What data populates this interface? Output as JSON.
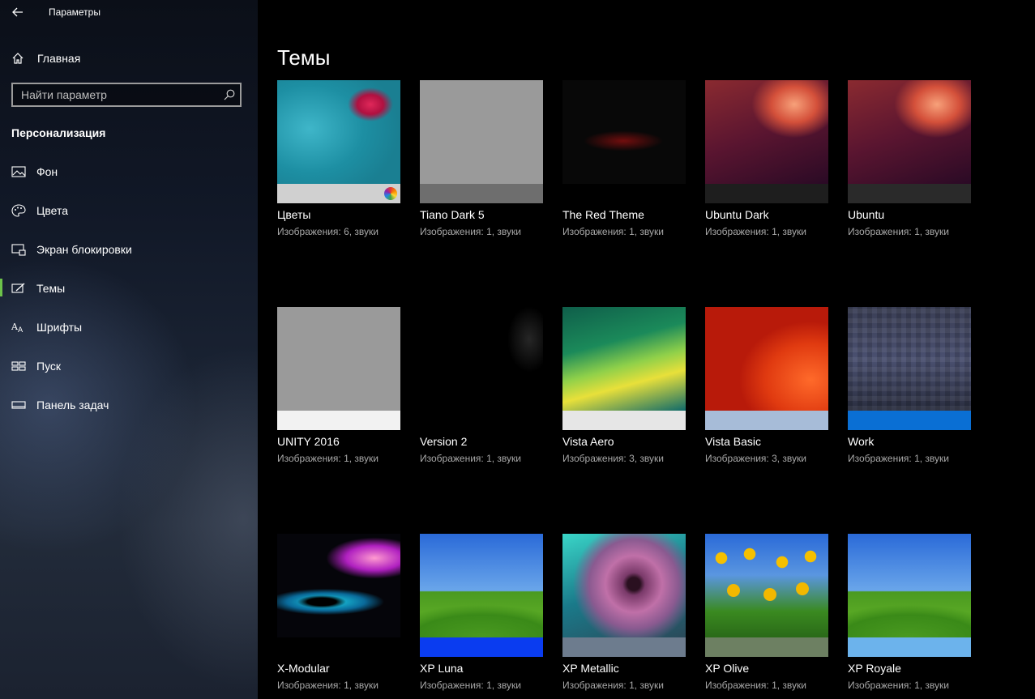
{
  "window": {
    "title": "Параметры"
  },
  "sidebar": {
    "home_label": "Главная",
    "search_placeholder": "Найти параметр",
    "section_title": "Персонализация",
    "items": [
      {
        "label": "Фон",
        "icon": "image-icon",
        "selected": false
      },
      {
        "label": "Цвета",
        "icon": "palette-icon",
        "selected": false
      },
      {
        "label": "Экран блокировки",
        "icon": "lock-screen-icon",
        "selected": false
      },
      {
        "label": "Темы",
        "icon": "themes-icon",
        "selected": true
      },
      {
        "label": "Шрифты",
        "icon": "fonts-icon",
        "selected": false
      },
      {
        "label": "Пуск",
        "icon": "start-icon",
        "selected": false
      },
      {
        "label": "Панель задач",
        "icon": "taskbar-icon",
        "selected": false
      }
    ]
  },
  "main": {
    "title": "Темы",
    "themes": [
      {
        "name": "Цветы",
        "desc": "Изображения: 6, звуки",
        "bar_color": "#d0d0d0"
      },
      {
        "name": "Tiano Dark 5",
        "desc": "Изображения: 1, звуки",
        "bar_color": "#6e6e6e"
      },
      {
        "name": "The Red Theme",
        "desc": "Изображения: 1, звуки",
        "bar_color": "#000000"
      },
      {
        "name": "Ubuntu Dark",
        "desc": "Изображения: 1, звуки",
        "bar_color": "#1e1e1e"
      },
      {
        "name": "Ubuntu",
        "desc": "Изображения: 1, звуки",
        "bar_color": "#2a2a2a"
      },
      {
        "name": "UNITY 2016",
        "desc": "Изображения: 1, звуки",
        "bar_color": "#f2f2f2"
      },
      {
        "name": "Version 2",
        "desc": "Изображения: 1, звуки",
        "bar_color": "#000000"
      },
      {
        "name": "Vista Aero",
        "desc": "Изображения: 3, звуки",
        "bar_color": "#e6e6e6"
      },
      {
        "name": "Vista Basic",
        "desc": "Изображения: 3, звуки",
        "bar_color": "#a7bcd8"
      },
      {
        "name": "Work",
        "desc": "Изображения: 1, звуки",
        "bar_color": "#0a6fd4"
      },
      {
        "name": "X-Modular",
        "desc": "Изображения: 1, звуки",
        "bar_color": "#000000"
      },
      {
        "name": "XP Luna",
        "desc": "Изображения: 1, звуки",
        "bar_color": "#0a3cf0"
      },
      {
        "name": "XP Metallic",
        "desc": "Изображения: 1, звуки",
        "bar_color": "#6d7c8e"
      },
      {
        "name": "XP Olive",
        "desc": "Изображения: 1, звуки",
        "bar_color": "#6d8062"
      },
      {
        "name": "XP Royale",
        "desc": "Изображения: 1, звуки",
        "bar_color": "#6cb3ec"
      }
    ]
  },
  "colors": {
    "accent": "#6cc24a",
    "sidebar_bg": "#141b28",
    "main_bg": "#000000"
  }
}
